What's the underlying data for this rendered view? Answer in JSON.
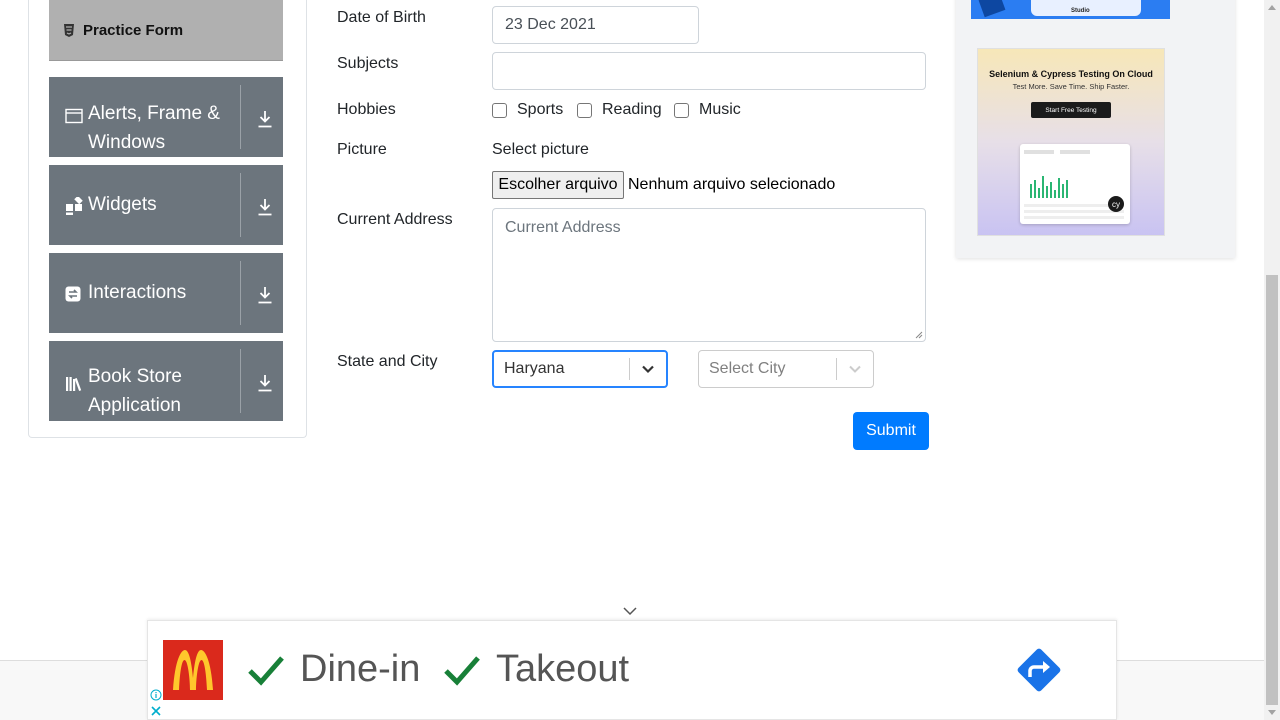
{
  "sidebar": {
    "active_item": "Practice Form",
    "groups": [
      {
        "label": "Alerts, Frame & Windows",
        "icon": "browser-window-icon"
      },
      {
        "label": "Widgets",
        "icon": "widgets-grid-icon"
      },
      {
        "label": "Interactions",
        "icon": "interactions-swap-icon"
      },
      {
        "label": "Book Store Application",
        "icon": "books-icon"
      }
    ]
  },
  "form": {
    "dob_label": "Date of Birth",
    "dob_value": "23 Dec 2021",
    "subjects_label": "Subjects",
    "subjects_value": "",
    "hobbies_label": "Hobbies",
    "hobbies": [
      {
        "label": "Sports",
        "checked": false
      },
      {
        "label": "Reading",
        "checked": false
      },
      {
        "label": "Music",
        "checked": false
      }
    ],
    "picture_label": "Picture",
    "picture_prompt": "Select picture",
    "file_button": "Escolher arquivo",
    "file_status": "Nenhum arquivo selecionado",
    "address_label": "Current Address",
    "address_placeholder": "Current Address",
    "state_city_label": "State and City",
    "state_value": "Haryana",
    "city_placeholder": "Select City",
    "submit_label": "Submit"
  },
  "right_ad": {
    "studio_text": "Studio",
    "headline": "Selenium & Cypress Testing On Cloud",
    "tagline": "Test More. Save Time. Ship Faster.",
    "button": "Start Free Testing",
    "badge": "cy"
  },
  "bottom_ad": {
    "option1": "Dine-in",
    "option2": "Takeout",
    "brand_color": "#da291c",
    "check_color": "#188038",
    "icon_color": "#1a73e8"
  },
  "colors": {
    "sidebar_group": "#6c757d",
    "active_item": "#b0b0b0",
    "primary": "#007bff",
    "focus_border": "#2684ff"
  }
}
